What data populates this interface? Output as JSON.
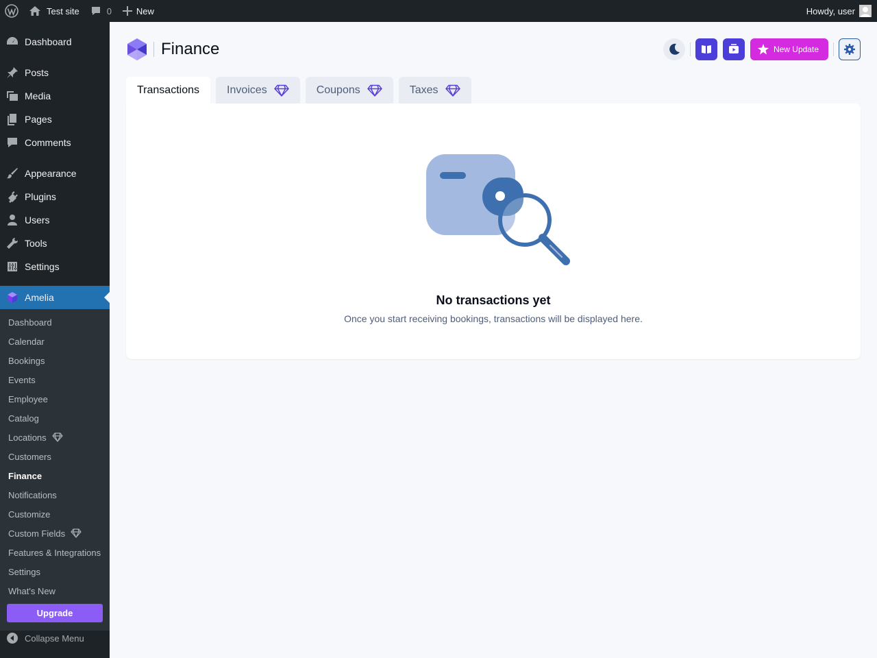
{
  "adminbar": {
    "site_name": "Test site",
    "comments_count": "0",
    "new_label": "New",
    "greeting": "Howdy, user"
  },
  "sidebar": {
    "top_items": [
      {
        "label": "Dashboard",
        "icon": "dashboard-icon"
      },
      {
        "label": "Posts",
        "icon": "pin-icon"
      },
      {
        "label": "Media",
        "icon": "media-icon"
      },
      {
        "label": "Pages",
        "icon": "pages-icon"
      },
      {
        "label": "Comments",
        "icon": "comment-icon"
      },
      {
        "label": "Appearance",
        "icon": "brush-icon"
      },
      {
        "label": "Plugins",
        "icon": "plug-icon"
      },
      {
        "label": "Users",
        "icon": "user-icon"
      },
      {
        "label": "Tools",
        "icon": "wrench-icon"
      },
      {
        "label": "Settings",
        "icon": "sliders-icon"
      },
      {
        "label": "Amelia",
        "icon": "amelia-icon"
      }
    ],
    "sub_items": [
      "Dashboard",
      "Calendar",
      "Bookings",
      "Events",
      "Employee",
      "Catalog",
      "Locations",
      "Customers",
      "Finance",
      "Notifications",
      "Customize",
      "Custom Fields",
      "Features & Integrations",
      "Settings",
      "What's New"
    ],
    "upgrade_label": "Upgrade",
    "collapse_label": "Collapse Menu"
  },
  "header": {
    "title": "Finance",
    "new_update_label": "New Update"
  },
  "tabs": [
    {
      "label": "Transactions",
      "active": true,
      "premium": false
    },
    {
      "label": "Invoices",
      "active": false,
      "premium": true
    },
    {
      "label": "Coupons",
      "active": false,
      "premium": true
    },
    {
      "label": "Taxes",
      "active": false,
      "premium": true
    }
  ],
  "empty_state": {
    "title": "No transactions yet",
    "subtitle": "Once you start receiving bookings, transactions will be displayed here."
  },
  "colors": {
    "accent": "#2271b1",
    "brand_purple": "#4c3ed8",
    "new_update": "#d52be0",
    "upgrade": "#8b5cf6"
  }
}
